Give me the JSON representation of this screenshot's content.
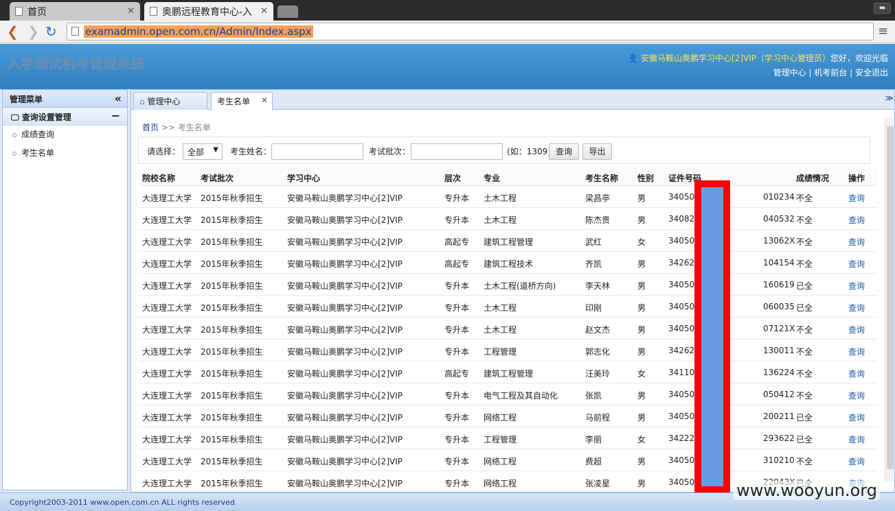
{
  "browser": {
    "tabs": [
      {
        "title": "首页"
      },
      {
        "title": "奥鹏远程教育中心-入"
      }
    ],
    "url": "examadmin.open.com.cn/Admin/Index.aspx"
  },
  "header": {
    "title": "入学测试机考管理系统",
    "user": "安徽马鞍山奥鹏学习中心[2]VIP（学习中心管理员）",
    "greeting": "您好，欢迎光临",
    "links": [
      "管理中心",
      "机考前台",
      "安全退出"
    ]
  },
  "sidebar": {
    "title": "管理菜单",
    "section": "查询设置管理",
    "items": [
      "成绩查询",
      "考生名单"
    ]
  },
  "main": {
    "tabs": [
      "管理中心",
      "考生名单"
    ],
    "breadcrumb": {
      "home": "首页",
      "sep": ">>",
      "current": "考生名单"
    },
    "filters": {
      "select_label": "请选择：",
      "select_value": "全部",
      "name_label": "考生姓名：",
      "batch_label": "考试批次：",
      "hint": "(如：1309)",
      "query_button": "查询",
      "export_button": "导出"
    },
    "table": {
      "columns": [
        "院校名称",
        "考试批次",
        "学习中心",
        "层次",
        "专业",
        "考生名称",
        "性别",
        "证件号码",
        "成绩情况",
        "操作"
      ],
      "rows": [
        [
          "大连理工大学",
          "2015年秋季招生",
          "安徽马鞍山奥鹏学习中心[2]VIP",
          "专升本",
          "土木工程",
          "梁昌亭",
          "男",
          "34050",
          "010234",
          "不全",
          "查询"
        ],
        [
          "大连理工大学",
          "2015年秋季招生",
          "安徽马鞍山奥鹏学习中心[2]VIP",
          "专升本",
          "土木工程",
          "陈杰贵",
          "男",
          "34082",
          "040532",
          "不全",
          "查询"
        ],
        [
          "大连理工大学",
          "2015年秋季招生",
          "安徽马鞍山奥鹏学习中心[2]VIP",
          "高起专",
          "建筑工程管理",
          "武红",
          "女",
          "34050",
          "13062X",
          "不全",
          "查询"
        ],
        [
          "大连理工大学",
          "2015年秋季招生",
          "安徽马鞍山奥鹏学习中心[2]VIP",
          "高起专",
          "建筑工程技术",
          "齐凯",
          "男",
          "34262",
          "104154",
          "不全",
          "查询"
        ],
        [
          "大连理工大学",
          "2015年秋季招生",
          "安徽马鞍山奥鹏学习中心[2]VIP",
          "专升本",
          "土木工程(道桥方向)",
          "李天林",
          "男",
          "34050",
          "160619",
          "已全",
          "查询"
        ],
        [
          "大连理工大学",
          "2015年秋季招生",
          "安徽马鞍山奥鹏学习中心[2]VIP",
          "专升本",
          "土木工程",
          "印刚",
          "男",
          "34050",
          "060035",
          "已全",
          "查询"
        ],
        [
          "大连理工大学",
          "2015年秋季招生",
          "安徽马鞍山奥鹏学习中心[2]VIP",
          "专升本",
          "土木工程",
          "赵文杰",
          "男",
          "34050",
          "07121X",
          "不全",
          "查询"
        ],
        [
          "大连理工大学",
          "2015年秋季招生",
          "安徽马鞍山奥鹏学习中心[2]VIP",
          "专升本",
          "工程管理",
          "郭志化",
          "男",
          "34262",
          "130011",
          "不全",
          "查询"
        ],
        [
          "大连理工大学",
          "2015年秋季招生",
          "安徽马鞍山奥鹏学习中心[2]VIP",
          "高起专",
          "建筑工程管理",
          "汪美玲",
          "女",
          "34110",
          "136224",
          "不全",
          "查询"
        ],
        [
          "大连理工大学",
          "2015年秋季招生",
          "安徽马鞍山奥鹏学习中心[2]VIP",
          "专升本",
          "电气工程及其自动化",
          "张凯",
          "男",
          "34050",
          "050412",
          "不全",
          "查询"
        ],
        [
          "大连理工大学",
          "2015年秋季招生",
          "安徽马鞍山奥鹏学习中心[2]VIP",
          "专升本",
          "网络工程",
          "马前程",
          "男",
          "34050",
          "200211",
          "已全",
          "查询"
        ],
        [
          "大连理工大学",
          "2015年秋季招生",
          "安徽马鞍山奥鹏学习中心[2]VIP",
          "专升本",
          "工程管理",
          "李丽",
          "女",
          "34222",
          "293622",
          "已全",
          "查询"
        ],
        [
          "大连理工大学",
          "2015年秋季招生",
          "安徽马鞍山奥鹏学习中心[2]VIP",
          "专升本",
          "网络工程",
          "费超",
          "男",
          "34050",
          "310210",
          "不全",
          "查询"
        ],
        [
          "大连理工大学",
          "2015年秋季招生",
          "安徽马鞍山奥鹏学习中心[2]VIP",
          "专升本",
          "网络工程",
          "张凌星",
          "男",
          "34050",
          "22043X",
          "已全",
          "查询"
        ]
      ]
    }
  },
  "footer": {
    "copyright": "Copyright2003-2011 www.open.com.cn ALL rights reserved",
    "watermark": "www.wooyun.org"
  },
  "colors": {
    "header_bg": "#3a8ccc",
    "redaction": "#ff0000",
    "link": "#1a5aa8"
  }
}
